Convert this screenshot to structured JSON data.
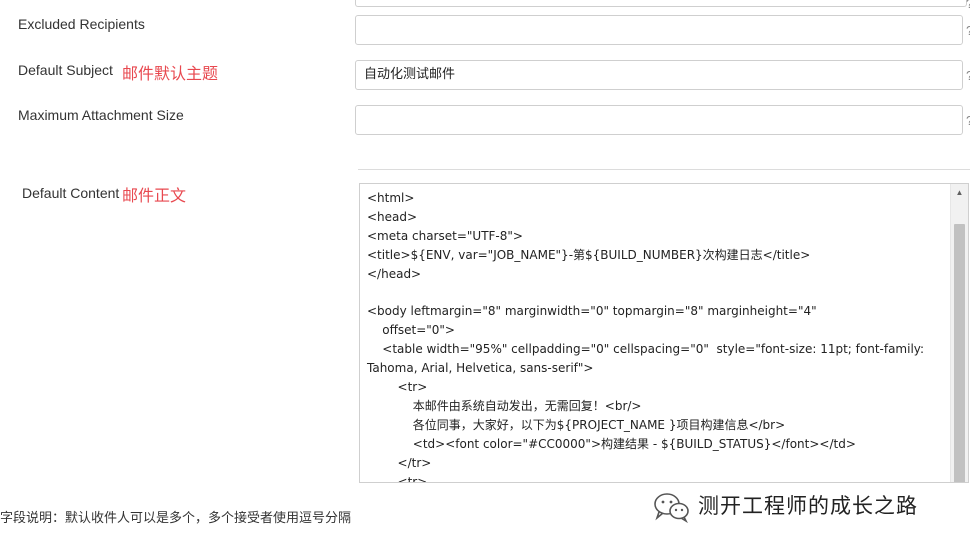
{
  "form": {
    "excluded_recipients": {
      "label": "Excluded Recipients",
      "value": ""
    },
    "default_subject": {
      "label": "Default Subject",
      "annotation": "邮件默认主题",
      "value": "自动化测试邮件"
    },
    "max_attachment_size": {
      "label": "Maximum Attachment Size",
      "value": ""
    },
    "default_content": {
      "label": "Default Content",
      "annotation": "邮件正文",
      "lines": [
        "<html>",
        "<head>",
        "<meta charset=\"UTF-8\">",
        "<title>${ENV, var=\"JOB_NAME\"}-第${BUILD_NUMBER}次构建日志</title>",
        "</head>",
        "",
        "<body leftmargin=\"8\" marginwidth=\"0\" topmargin=\"8\" marginheight=\"4\"",
        "    offset=\"0\">",
        "    <table width=\"95%\" cellpadding=\"0\" cellspacing=\"0\"  style=\"font-size: 11pt; font-family:",
        "Tahoma, Arial, Helvetica, sans-serif\">",
        "        <tr>",
        "            本邮件由系统自动发出，无需回复！<br/>",
        "            各位同事，大家好，以下为${PROJECT_NAME }项目构建信息</br>",
        "            <td><font color=\"#CC0000\">构建结果 - ${BUILD_STATUS}</font></td>",
        "        </tr>",
        "        <tr>"
      ]
    }
  },
  "footnote": "字段说明：默认收件人可以是多个，多个接受者使用逗号分隔",
  "watermark": {
    "text": "测开工程师的成长之路",
    "icon": "wechat-icon"
  },
  "colors": {
    "annotation": "#e8484f"
  }
}
